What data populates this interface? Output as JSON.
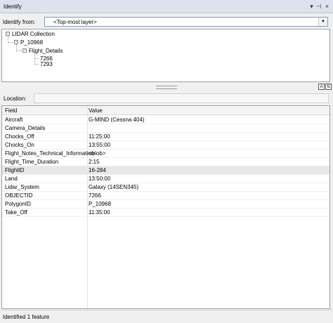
{
  "window": {
    "title": "Identify"
  },
  "identify_from": {
    "label": "Identify from:",
    "value": "<Top-most layer>"
  },
  "tree": {
    "root": "LIDAR Collection",
    "level1": "P_10968",
    "level2": "Flight_Details",
    "leaves": [
      "7266",
      "7293"
    ]
  },
  "location": {
    "label": "Location:",
    "value": ""
  },
  "grid": {
    "headers": {
      "field": "Field",
      "value": "Value"
    },
    "rows": [
      {
        "field": "Aircraft",
        "value": "G-MIND (Cessna 404)"
      },
      {
        "field": "Camera_Details",
        "value": ""
      },
      {
        "field": "Chocks_Off",
        "value": "11:25:00"
      },
      {
        "field": "Chocks_On",
        "value": "13:55:00"
      },
      {
        "field": "Flight_Notes_Technical_Information",
        "value": "<blob>"
      },
      {
        "field": "Flight_Time_Duration",
        "value": "2:15"
      },
      {
        "field": "FlightID",
        "value": "16-284"
      },
      {
        "field": "Land",
        "value": "13:50:00"
      },
      {
        "field": "Lidar_System",
        "value": "Galaxy (14SEN345)"
      },
      {
        "field": "OBJECTID",
        "value": "7266"
      },
      {
        "field": "PolygonID",
        "value": "P_10968"
      },
      {
        "field": "Take_Off",
        "value": "11:35:00"
      }
    ]
  },
  "status": {
    "text": "Identified 1 feature"
  }
}
